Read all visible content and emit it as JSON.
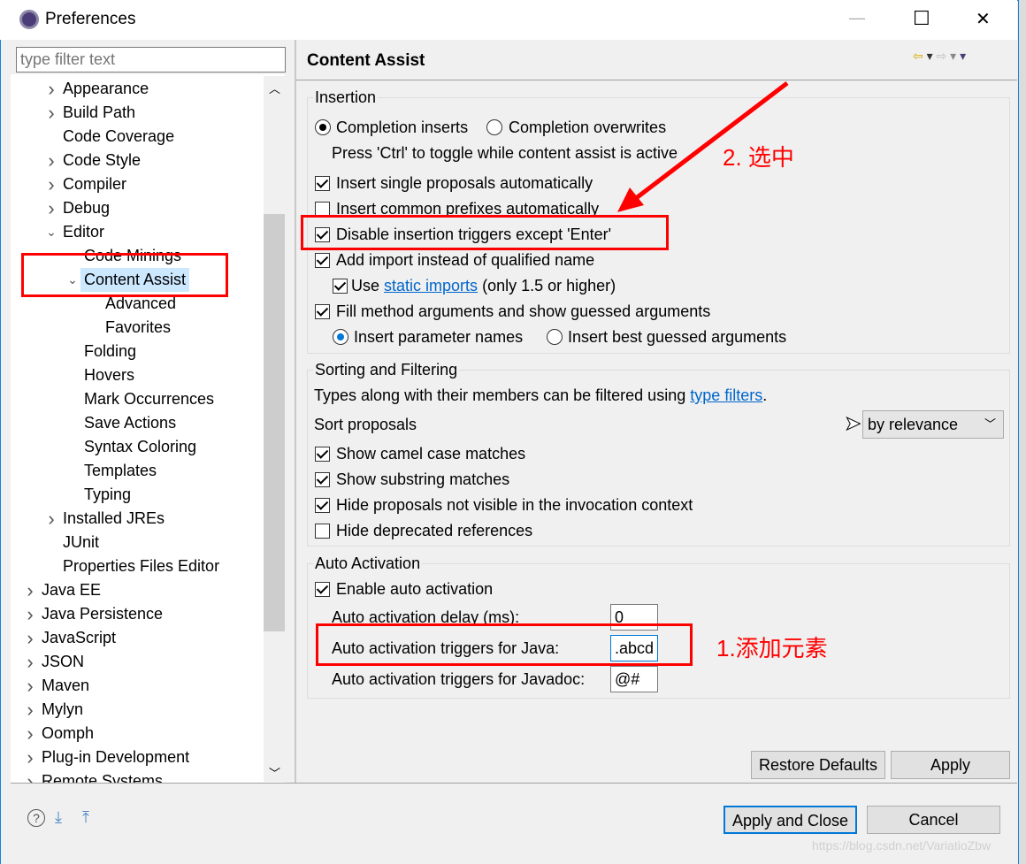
{
  "window": {
    "title": "Preferences",
    "minimize": "—",
    "maximize": "☐",
    "close": "✕"
  },
  "filter": {
    "placeholder": "type filter text"
  },
  "tree": [
    {
      "label": "Appearance",
      "level": 1,
      "chevron": "right"
    },
    {
      "label": "Build Path",
      "level": 1,
      "chevron": "right"
    },
    {
      "label": "Code Coverage",
      "level": 1,
      "chevron": ""
    },
    {
      "label": "Code Style",
      "level": 1,
      "chevron": "right"
    },
    {
      "label": "Compiler",
      "level": 1,
      "chevron": "right"
    },
    {
      "label": "Debug",
      "level": 1,
      "chevron": "right"
    },
    {
      "label": "Editor",
      "level": 1,
      "chevron": "down"
    },
    {
      "label": "Code Minings",
      "level": 2,
      "chevron": ""
    },
    {
      "label": "Content Assist",
      "level": 2,
      "chevron": "down",
      "selected": true
    },
    {
      "label": "Advanced",
      "level": 3,
      "chevron": ""
    },
    {
      "label": "Favorites",
      "level": 3,
      "chevron": ""
    },
    {
      "label": "Folding",
      "level": 2,
      "chevron": ""
    },
    {
      "label": "Hovers",
      "level": 2,
      "chevron": ""
    },
    {
      "label": "Mark Occurrences",
      "level": 2,
      "chevron": ""
    },
    {
      "label": "Save Actions",
      "level": 2,
      "chevron": ""
    },
    {
      "label": "Syntax Coloring",
      "level": 2,
      "chevron": ""
    },
    {
      "label": "Templates",
      "level": 2,
      "chevron": ""
    },
    {
      "label": "Typing",
      "level": 2,
      "chevron": ""
    },
    {
      "label": "Installed JREs",
      "level": 1,
      "chevron": "right"
    },
    {
      "label": "JUnit",
      "level": 1,
      "chevron": ""
    },
    {
      "label": "Properties Files Editor",
      "level": 1,
      "chevron": ""
    },
    {
      "label": "Java EE",
      "level": 0,
      "chevron": "right"
    },
    {
      "label": "Java Persistence",
      "level": 0,
      "chevron": "right"
    },
    {
      "label": "JavaScript",
      "level": 0,
      "chevron": "right"
    },
    {
      "label": "JSON",
      "level": 0,
      "chevron": "right"
    },
    {
      "label": "Maven",
      "level": 0,
      "chevron": "right"
    },
    {
      "label": "Mylyn",
      "level": 0,
      "chevron": "right"
    },
    {
      "label": "Oomph",
      "level": 0,
      "chevron": "right"
    },
    {
      "label": "Plug-in Development",
      "level": 0,
      "chevron": "right"
    },
    {
      "label": "Remote Systems",
      "level": 0,
      "chevron": "right"
    }
  ],
  "page": {
    "title": "Content Assist"
  },
  "insertion": {
    "label": "Insertion",
    "completion_inserts": "Completion inserts",
    "completion_overwrites": "Completion overwrites",
    "toggle_hint": "Press 'Ctrl' to toggle while content assist is active",
    "insert_single": "Insert single proposals automatically",
    "insert_common": "Insert common prefixes automatically",
    "disable_triggers": "Disable insertion triggers except 'Enter'",
    "add_import": "Add import instead of qualified name",
    "use": "Use",
    "static_imports": "static imports",
    "only_15": "(only 1.5 or higher)",
    "fill_args": "Fill method arguments and show guessed arguments",
    "insert_param_names": "Insert parameter names",
    "insert_best_guessed": "Insert best guessed arguments"
  },
  "sorting": {
    "label": "Sorting and Filtering",
    "types_text": "Types along with their members can be filtered using",
    "type_filters": "type filters",
    "period": ".",
    "sort_label": "Sort proposals",
    "sort_value": "by relevance",
    "camel": "Show camel case matches",
    "substring": "Show substring matches",
    "hide_not_visible": "Hide proposals not visible in the invocation context",
    "hide_deprecated": "Hide deprecated references"
  },
  "auto": {
    "label": "Auto Activation",
    "enable": "Enable auto activation",
    "delay_label": "Auto activation delay (ms):",
    "delay_value": "0",
    "java_label": "Auto activation triggers for Java:",
    "java_value": ".abcd",
    "javadoc_label": "Auto activation triggers for Javadoc:",
    "javadoc_value": "@#"
  },
  "buttons": {
    "restore": "Restore Defaults",
    "apply": "Apply",
    "apply_close": "Apply and Close",
    "cancel": "Cancel"
  },
  "annotations": {
    "step2": "2. 选中",
    "step1": "1.添加元素",
    "color": "#ff0000"
  },
  "watermark": "https://blog.csdn.net/VariatioZbw"
}
